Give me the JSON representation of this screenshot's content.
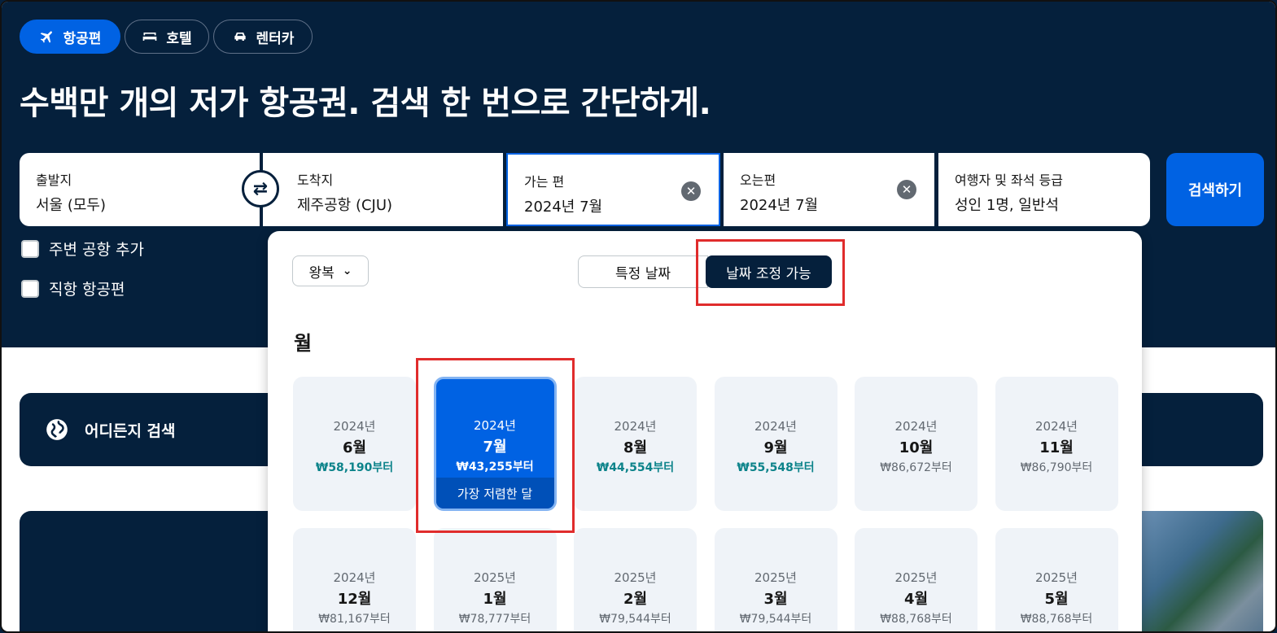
{
  "tabs": [
    {
      "label": "항공편",
      "icon": "airplane-icon",
      "active": true
    },
    {
      "label": "호텔",
      "icon": "bed-icon",
      "active": false
    },
    {
      "label": "렌터카",
      "icon": "car-icon",
      "active": false
    }
  ],
  "headline": "수백만 개의 저가 항공권. 검색 한 번으로 간단하게.",
  "search": {
    "origin": {
      "label": "출발지",
      "value": "서울 (모두)"
    },
    "destination": {
      "label": "도착지",
      "value": "제주공항 (CJU)"
    },
    "depart": {
      "label": "가는 편",
      "value": "2024년 7월"
    },
    "return": {
      "label": "오는편",
      "value": "2024년 7월"
    },
    "travellers": {
      "label": "여행자 및 좌석 등급",
      "value": "성인 1명, 일반석"
    },
    "button": "검색하기"
  },
  "options": {
    "nearby": "주변 공항 추가",
    "direct": "직항 항공편"
  },
  "anywhere": "어디든지 검색",
  "picker": {
    "trip_type": "왕복",
    "specific": "특정 날짜",
    "flexible": "날짜 조정 가능",
    "section_title": "월",
    "cheapest_label": "가장 저렴한 달",
    "months": [
      {
        "year": "2024년",
        "month": "6월",
        "price": "₩58,190부터",
        "highlight": true
      },
      {
        "year": "2024년",
        "month": "7월",
        "price": "₩43,255부터",
        "selected": true
      },
      {
        "year": "2024년",
        "month": "8월",
        "price": "₩44,554부터",
        "highlight": true
      },
      {
        "year": "2024년",
        "month": "9월",
        "price": "₩55,548부터",
        "highlight": true
      },
      {
        "year": "2024년",
        "month": "10월",
        "price": "₩86,672부터"
      },
      {
        "year": "2024년",
        "month": "11월",
        "price": "₩86,790부터"
      },
      {
        "year": "2024년",
        "month": "12월",
        "price": "₩81,167부터"
      },
      {
        "year": "2025년",
        "month": "1월",
        "price": "₩78,777부터"
      },
      {
        "year": "2025년",
        "month": "2월",
        "price": "₩79,544부터"
      },
      {
        "year": "2025년",
        "month": "3월",
        "price": "₩79,544부터"
      },
      {
        "year": "2025년",
        "month": "4월",
        "price": "₩88,768부터"
      },
      {
        "year": "2025년",
        "month": "5월",
        "price": "₩88,768부터"
      }
    ]
  },
  "colors": {
    "navy": "#05203c",
    "blue": "#0062e3",
    "teal": "#0c838a",
    "highlight_red": "#e02c2c"
  }
}
